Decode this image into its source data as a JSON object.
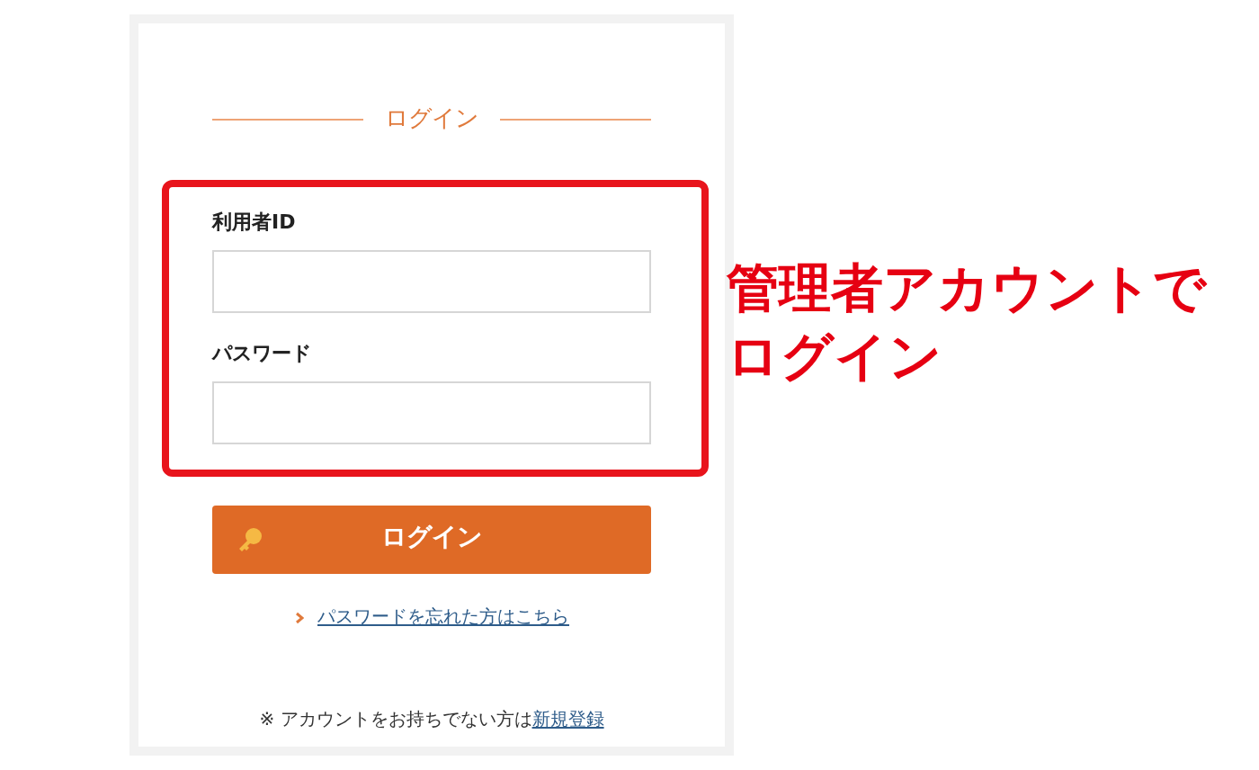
{
  "heading": "ログイン",
  "fields": [
    {
      "label": "利用者ID"
    },
    {
      "label": "パスワード"
    }
  ],
  "login_button": "ログイン",
  "forgot_link": "パスワードを忘れた方はこちら",
  "signup_note": "※ アカウントをお持ちでない方は",
  "signup_link": "新規登録",
  "annotation": "管理者アカウントでログイン"
}
